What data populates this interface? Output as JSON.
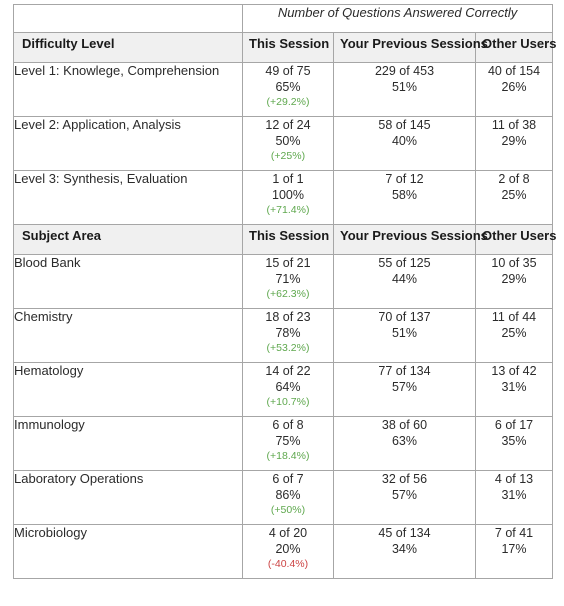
{
  "table": {
    "caption": "Number of Questions Answered Correctly",
    "caption_blank": "",
    "colors": {
      "header_background": "#f0f0f0",
      "border": "#a6a6a6",
      "delta_positive": "#5fa84e",
      "delta_negative": "#cc4444",
      "text": "#2b2b2b"
    },
    "columns": {
      "session": "This Session",
      "previous": "Your Previous Sessions",
      "other": "Other Users"
    },
    "sections": [
      {
        "header": "Difficulty Level",
        "rows": [
          {
            "label": "Level 1: Knowlege, Comprehension",
            "session": {
              "fraction": "49 of 75",
              "percent": "65%",
              "delta": "(+29.2%)",
              "delta_dir": "up"
            },
            "previous": {
              "fraction": "229 of 453",
              "percent": "51%",
              "delta": "",
              "delta_dir": "none"
            },
            "other": {
              "fraction": "40 of 154",
              "percent": "26%",
              "delta": "",
              "delta_dir": "none"
            }
          },
          {
            "label": "Level 2: Application, Analysis",
            "session": {
              "fraction": "12 of 24",
              "percent": "50%",
              "delta": "(+25%)",
              "delta_dir": "up"
            },
            "previous": {
              "fraction": "58 of 145",
              "percent": "40%",
              "delta": "",
              "delta_dir": "none"
            },
            "other": {
              "fraction": "11 of 38",
              "percent": "29%",
              "delta": "",
              "delta_dir": "none"
            }
          },
          {
            "label": "Level 3: Synthesis, Evaluation",
            "session": {
              "fraction": "1 of 1",
              "percent": "100%",
              "delta": "(+71.4%)",
              "delta_dir": "up"
            },
            "previous": {
              "fraction": "7 of 12",
              "percent": "58%",
              "delta": "",
              "delta_dir": "none"
            },
            "other": {
              "fraction": "2 of 8",
              "percent": "25%",
              "delta": "",
              "delta_dir": "none"
            }
          }
        ]
      },
      {
        "header": "Subject Area",
        "rows": [
          {
            "label": "Blood Bank",
            "session": {
              "fraction": "15 of 21",
              "percent": "71%",
              "delta": "(+62.3%)",
              "delta_dir": "up"
            },
            "previous": {
              "fraction": "55 of 125",
              "percent": "44%",
              "delta": "",
              "delta_dir": "none"
            },
            "other": {
              "fraction": "10 of 35",
              "percent": "29%",
              "delta": "",
              "delta_dir": "none"
            }
          },
          {
            "label": "Chemistry",
            "session": {
              "fraction": "18 of 23",
              "percent": "78%",
              "delta": "(+53.2%)",
              "delta_dir": "up"
            },
            "previous": {
              "fraction": "70 of 137",
              "percent": "51%",
              "delta": "",
              "delta_dir": "none"
            },
            "other": {
              "fraction": "11 of 44",
              "percent": "25%",
              "delta": "",
              "delta_dir": "none"
            }
          },
          {
            "label": "Hematology",
            "session": {
              "fraction": "14 of 22",
              "percent": "64%",
              "delta": "(+10.7%)",
              "delta_dir": "up"
            },
            "previous": {
              "fraction": "77 of 134",
              "percent": "57%",
              "delta": "",
              "delta_dir": "none"
            },
            "other": {
              "fraction": "13 of 42",
              "percent": "31%",
              "delta": "",
              "delta_dir": "none"
            }
          },
          {
            "label": "Immunology",
            "session": {
              "fraction": "6 of 8",
              "percent": "75%",
              "delta": "(+18.4%)",
              "delta_dir": "up"
            },
            "previous": {
              "fraction": "38 of 60",
              "percent": "63%",
              "delta": "",
              "delta_dir": "none"
            },
            "other": {
              "fraction": "6 of 17",
              "percent": "35%",
              "delta": "",
              "delta_dir": "none"
            }
          },
          {
            "label": "Laboratory Operations",
            "session": {
              "fraction": "6 of 7",
              "percent": "86%",
              "delta": "(+50%)",
              "delta_dir": "up"
            },
            "previous": {
              "fraction": "32 of 56",
              "percent": "57%",
              "delta": "",
              "delta_dir": "none"
            },
            "other": {
              "fraction": "4 of 13",
              "percent": "31%",
              "delta": "",
              "delta_dir": "none"
            }
          },
          {
            "label": "Microbiology",
            "session": {
              "fraction": "4 of 20",
              "percent": "20%",
              "delta": "(-40.4%)",
              "delta_dir": "down"
            },
            "previous": {
              "fraction": "45 of 134",
              "percent": "34%",
              "delta": "",
              "delta_dir": "none"
            },
            "other": {
              "fraction": "7 of 41",
              "percent": "17%",
              "delta": "",
              "delta_dir": "none"
            }
          }
        ]
      }
    ]
  }
}
